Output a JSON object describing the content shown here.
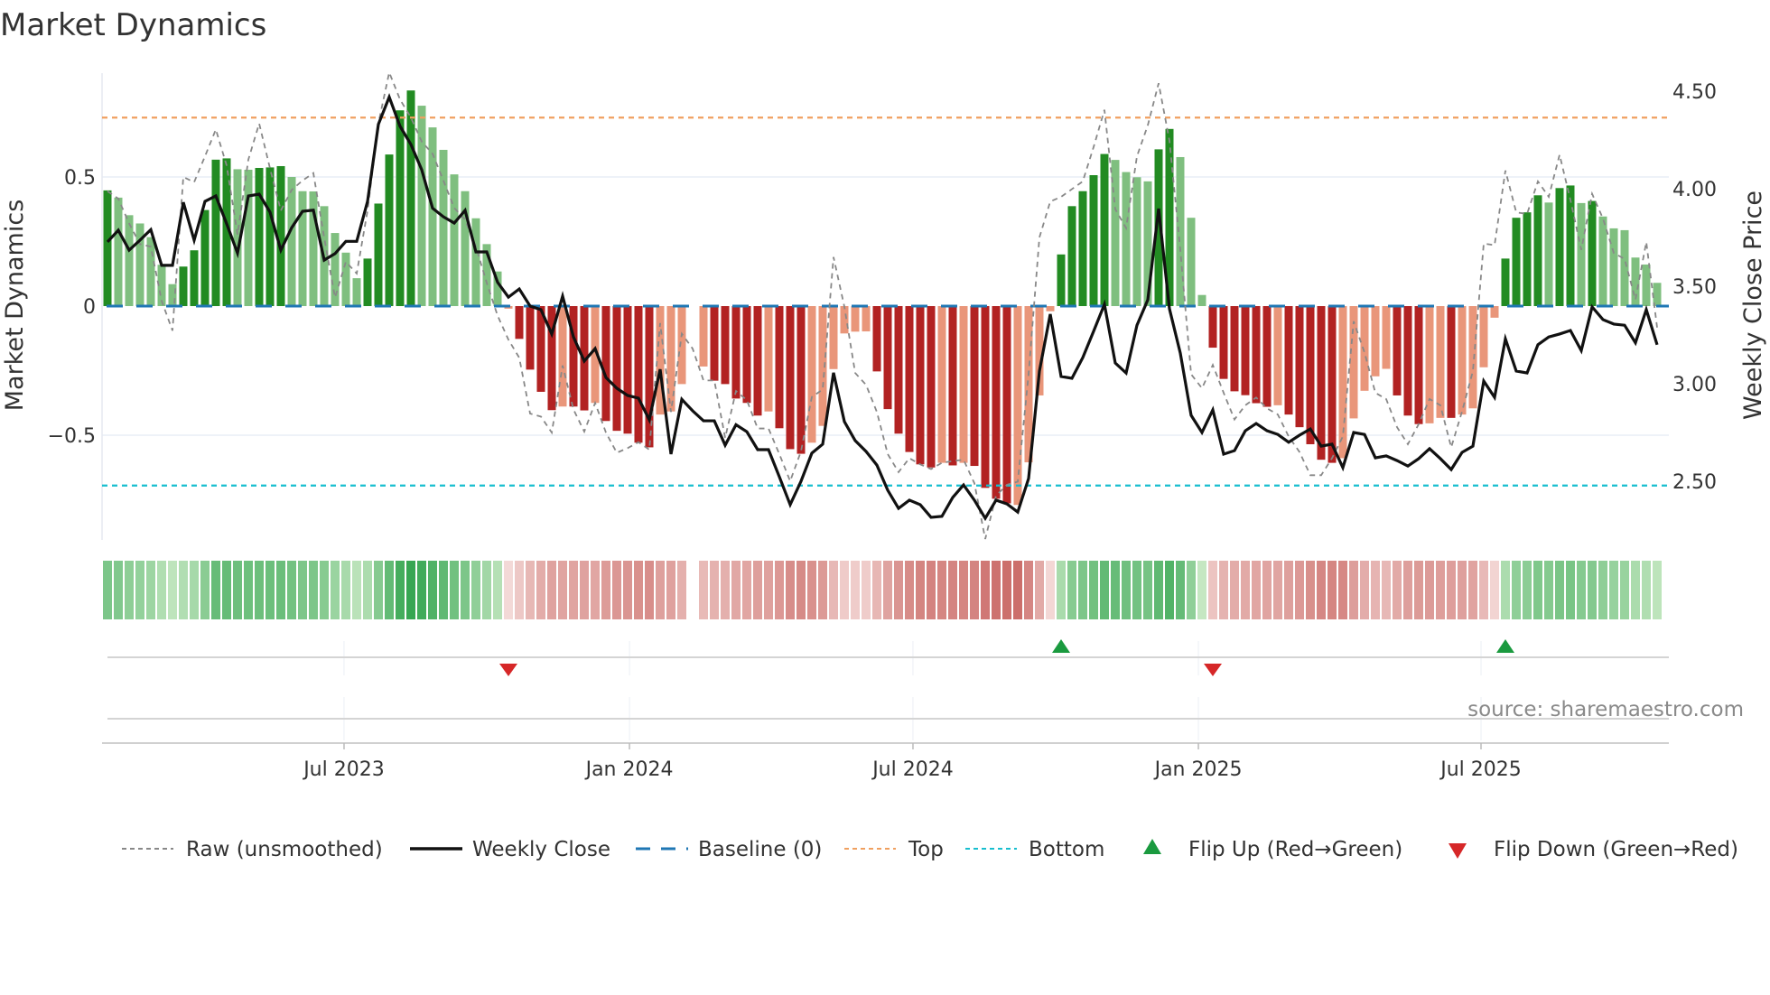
{
  "chart_data": {
    "type": "bar",
    "title": "Market Dynamics",
    "ylabel": "Market Dynamics",
    "y2label": "Weekly Close Price",
    "ylim": [
      -0.906,
      0.9
    ],
    "y2lim": [
      2.2,
      4.6
    ],
    "left_ticks": [
      {
        "v": 0.5,
        "label": "0.5"
      },
      {
        "v": 0,
        "label": "0"
      },
      {
        "v": -0.5,
        "label": "−0.5"
      }
    ],
    "right_ticks": [
      {
        "v": 4.5,
        "label": "4.50"
      },
      {
        "v": 4.0,
        "label": "4.00"
      },
      {
        "v": 3.5,
        "label": "3.50"
      },
      {
        "v": 3.0,
        "label": "3.00"
      },
      {
        "v": 2.5,
        "label": "2.50"
      }
    ],
    "x_ticks": [
      {
        "week": 21.83,
        "label": "Jul 2023"
      },
      {
        "week": 48.17,
        "label": "Jan 2024"
      },
      {
        "week": 74.33,
        "label": "Jul 2024"
      },
      {
        "week": 100.67,
        "label": "Jan 2025"
      },
      {
        "week": 126.75,
        "label": "Jul 2025"
      }
    ],
    "top_level": 0.73,
    "bottom_level": -0.695,
    "baseline": 0,
    "momentum": [
      0.448,
      0.42,
      0.352,
      0.32,
      0.267,
      0.16,
      0.085,
      0.153,
      0.216,
      0.372,
      0.567,
      0.572,
      0.53,
      0.528,
      0.535,
      0.537,
      0.542,
      0.5,
      0.445,
      0.444,
      0.387,
      0.283,
      0.207,
      0.108,
      0.184,
      0.397,
      0.587,
      0.758,
      0.835,
      0.776,
      0.692,
      0.605,
      0.51,
      0.445,
      0.34,
      0.24,
      0.134,
      -0.01,
      -0.127,
      -0.246,
      -0.332,
      -0.403,
      -0.389,
      -0.389,
      -0.404,
      -0.375,
      -0.445,
      -0.483,
      -0.494,
      -0.529,
      -0.547,
      -0.42,
      -0.408,
      -0.302,
      null,
      -0.234,
      -0.289,
      -0.302,
      -0.358,
      -0.375,
      -0.424,
      -0.408,
      -0.473,
      -0.554,
      -0.572,
      -0.529,
      -0.464,
      -0.244,
      -0.106,
      -0.099,
      -0.098,
      -0.253,
      -0.399,
      -0.494,
      -0.565,
      -0.613,
      -0.625,
      -0.607,
      -0.617,
      -0.607,
      -0.619,
      -0.704,
      -0.746,
      -0.764,
      -0.77,
      -0.605,
      -0.346,
      -0.02,
      0.2,
      0.387,
      0.445,
      0.507,
      0.589,
      0.566,
      0.519,
      0.499,
      0.483,
      0.607,
      0.686,
      0.577,
      0.342,
      0.043,
      -0.161,
      -0.282,
      -0.33,
      -0.345,
      -0.376,
      -0.39,
      -0.384,
      -0.42,
      -0.469,
      -0.535,
      -0.595,
      -0.607,
      -0.589,
      -0.435,
      -0.328,
      -0.272,
      -0.243,
      -0.346,
      -0.424,
      -0.457,
      -0.454,
      -0.433,
      -0.433,
      -0.42,
      -0.396,
      -0.237,
      -0.045,
      0.184,
      0.342,
      0.363,
      0.429,
      0.401,
      0.457,
      0.467,
      0.399,
      0.407,
      0.347,
      0.301,
      0.294,
      0.188,
      0.161,
      0.09
    ],
    "strength": "DLLLLLLDDDDDLLDDDLLLLLLLDDDDDLLLLLLLLLDDDDLDDLDDDDDLLLLLDDDDDLDDDLLLLLLDDDDDDLDLDDDDLLLLDDDDDLLLLDDLLLDDDDDDLDDDDDLLLLLDDDLLDLLLLDDDDLDDLDLLLLLL",
    "raw": [
      0.445,
      0.416,
      0.32,
      0.24,
      0.23,
      0.02,
      -0.095,
      0.5,
      0.48,
      0.58,
      0.684,
      0.544,
      0.277,
      0.567,
      0.707,
      0.533,
      0.37,
      0.45,
      0.486,
      0.515,
      0.265,
      0.033,
      0.172,
      0.126,
      0.37,
      0.707,
      0.905,
      0.8,
      0.73,
      0.637,
      0.59,
      0.486,
      0.38,
      0.335,
      0.23,
      0.09,
      -0.037,
      -0.13,
      -0.2,
      -0.416,
      -0.428,
      -0.49,
      -0.23,
      -0.4,
      -0.486,
      -0.375,
      -0.49,
      -0.568,
      -0.55,
      -0.527,
      -0.556,
      -0.066,
      -0.41,
      -0.107,
      -0.165,
      -0.288,
      -0.288,
      -0.51,
      -0.329,
      -0.364,
      -0.474,
      -0.474,
      -0.573,
      -0.678,
      -0.562,
      -0.352,
      -0.323,
      0.19,
      -0.002,
      -0.259,
      -0.305,
      -0.41,
      -0.573,
      -0.643,
      -0.589,
      -0.613,
      -0.631,
      -0.607,
      -0.6,
      -0.595,
      -0.686,
      -0.902,
      -0.734,
      -0.692,
      -0.68,
      -0.264,
      0.266,
      0.405,
      0.423,
      0.453,
      0.483,
      0.616,
      0.76,
      0.375,
      0.302,
      0.58,
      0.7,
      0.863,
      0.64,
      0.218,
      -0.264,
      -0.318,
      -0.228,
      -0.336,
      -0.439,
      -0.384,
      -0.354,
      -0.396,
      -0.42,
      -0.505,
      -0.565,
      -0.655,
      -0.655,
      -0.589,
      -0.505,
      -0.059,
      -0.18,
      -0.336,
      -0.36,
      -0.469,
      -0.535,
      -0.457,
      -0.36,
      -0.384,
      -0.547,
      -0.408,
      -0.252,
      0.242,
      0.236,
      0.525,
      0.363,
      0.357,
      0.483,
      0.423,
      0.586,
      0.411,
      0.218,
      0.435,
      0.339,
      0.206,
      0.182,
      0.025,
      0.248,
      -0.083
    ],
    "close": [
      3.727,
      3.787,
      3.685,
      3.736,
      3.79,
      3.607,
      3.607,
      3.93,
      3.736,
      3.935,
      3.963,
      3.82,
      3.67,
      3.963,
      3.972,
      3.88,
      3.685,
      3.8,
      3.884,
      3.89,
      3.634,
      3.667,
      3.73,
      3.73,
      3.935,
      4.33,
      4.47,
      4.32,
      4.227,
      4.097,
      3.9,
      3.856,
      3.824,
      3.889,
      3.676,
      3.676,
      3.52,
      3.444,
      3.486,
      3.398,
      3.38,
      3.255,
      3.449,
      3.24,
      3.116,
      3.18,
      3.032,
      2.977,
      2.94,
      2.926,
      2.815,
      3.074,
      2.639,
      2.92,
      2.861,
      2.81,
      2.81,
      2.685,
      2.79,
      2.754,
      2.662,
      2.662,
      2.523,
      2.38,
      2.5,
      2.644,
      2.69,
      3.056,
      2.806,
      2.708,
      2.653,
      2.583,
      2.454,
      2.361,
      2.403,
      2.38,
      2.315,
      2.32,
      2.417,
      2.481,
      2.403,
      2.31,
      2.403,
      2.384,
      2.342,
      2.514,
      3.065,
      3.357,
      3.037,
      3.028,
      3.134,
      3.269,
      3.407,
      3.106,
      3.055,
      3.3,
      3.43,
      3.898,
      3.384,
      3.157,
      2.838,
      2.75,
      2.866,
      2.639,
      2.657,
      2.759,
      2.796,
      2.759,
      2.74,
      2.7,
      2.736,
      2.768,
      2.68,
      2.69,
      2.57,
      2.75,
      2.74,
      2.62,
      2.63,
      2.606,
      2.578,
      2.616,
      2.667,
      2.616,
      2.56,
      2.648,
      2.68,
      3.014,
      2.93,
      3.23,
      3.065,
      3.055,
      3.2,
      3.24,
      3.255,
      3.273,
      3.17,
      3.394,
      3.329,
      3.306,
      3.3,
      3.21,
      3.38,
      3.2
    ],
    "flips": [
      {
        "week": 37,
        "dir": "down"
      },
      {
        "week": 88,
        "dir": "up"
      },
      {
        "week": 102,
        "dir": "down"
      },
      {
        "week": 129,
        "dir": "up"
      }
    ],
    "legend": {
      "placement": "bottom",
      "raw": "Raw (unsmoothed)",
      "close": "Weekly Close",
      "baseline": "Baseline (0)",
      "top": "Top",
      "bottom": "Bottom",
      "flip_up": "Flip Up (Red→Green)",
      "flip_down": "Flip Down (Green→Red)"
    },
    "source": "source: sharemaestro.com",
    "colors": {
      "green_strong": "#228b22",
      "green_weak": "#7fbf7f",
      "red_strong": "#b22222",
      "red_weak": "#e9967a",
      "raw": "#888888",
      "close": "#111111",
      "baseline": "#1f77b4",
      "top": "#f0a060",
      "bottom": "#17becf",
      "flip_up": "#1a9a3f",
      "flip_down": "#d62728"
    }
  }
}
